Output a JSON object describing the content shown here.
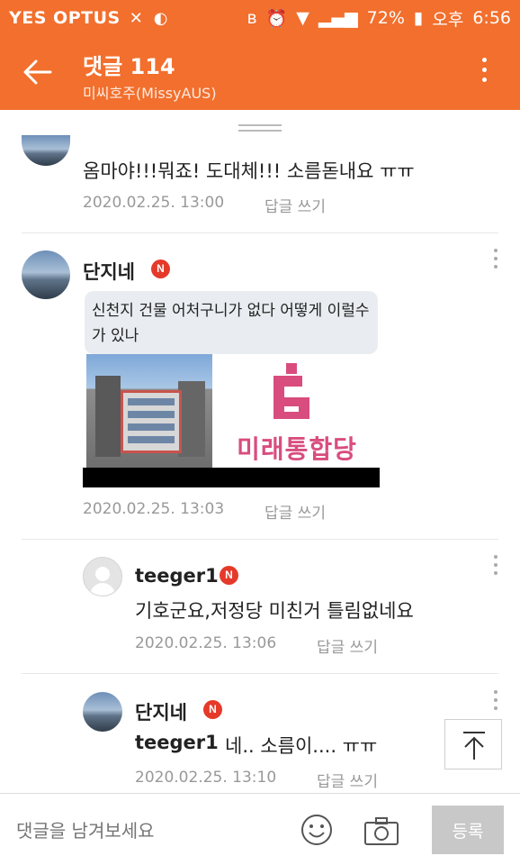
{
  "status_bar": {
    "carrier": "YES OPTUS",
    "battery": "72%",
    "ampm": "오후",
    "time": "6:56"
  },
  "header": {
    "title": "댓글 114",
    "subtitle": "미씨호주(MissyAUS)"
  },
  "comments": [
    {
      "text": "옴마야!!!뭐죠! 도대체!!! 소름돋내요 ㅠㅠ",
      "date": "2020.02.25. 13:00",
      "reply_label": "답글 쓰기"
    },
    {
      "author": "단지네",
      "badge": "N",
      "attachment": {
        "bubble_text": "신천지 건물 어처구니가 없다 어떻게 이럴수가 있나",
        "logo_text": "미래통합당"
      },
      "date": "2020.02.25. 13:03",
      "reply_label": "답글 쓰기"
    },
    {
      "author": "teeger1",
      "badge": "N",
      "text": "기호군요,저정당 미친거 틀림없네요",
      "date": "2020.02.25. 13:06",
      "reply_label": "답글 쓰기"
    },
    {
      "author": "단지네",
      "badge": "N",
      "mention": "teeger1",
      "text": "네.. 소름이.... ㅠㅠ",
      "date": "2020.02.25. 13:10",
      "reply_label": "답글 쓰기"
    }
  ],
  "compose": {
    "placeholder": "댓글을 남겨보세요",
    "submit_label": "등록"
  },
  "colors": {
    "brand": "#f26f2d",
    "badge": "#e53a2a"
  },
  "icons": [
    "back-arrow-icon",
    "more-vertical-icon",
    "scroll-to-top-icon",
    "emoji-icon",
    "camera-icon"
  ]
}
